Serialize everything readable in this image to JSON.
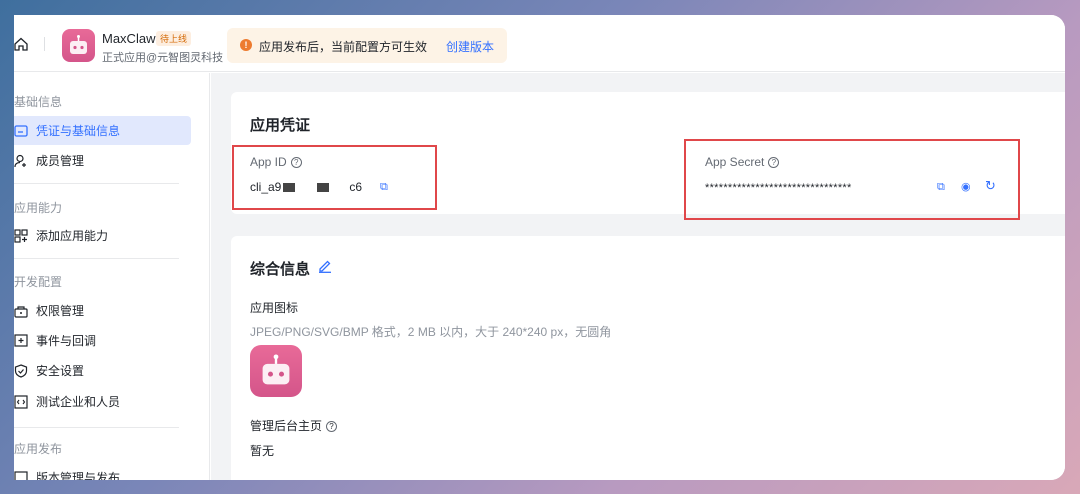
{
  "header": {
    "app_name": "MaxClaw",
    "status_badge": "待上线",
    "app_subtitle": "正式应用@元智图灵科技",
    "notice": {
      "text": "应用发布后，当前配置方可生效",
      "link": "创建版本"
    }
  },
  "sidebar": {
    "groups": [
      {
        "title": "基础信息",
        "items": [
          {
            "label": "凭证与基础信息",
            "active": true
          },
          {
            "label": "成员管理"
          }
        ]
      },
      {
        "title": "应用能力",
        "items": [
          {
            "label": "添加应用能力"
          }
        ]
      },
      {
        "title": "开发配置",
        "items": [
          {
            "label": "权限管理"
          },
          {
            "label": "事件与回调"
          },
          {
            "label": "安全设置"
          },
          {
            "label": "测试企业和人员"
          }
        ]
      },
      {
        "title": "应用发布",
        "items": [
          {
            "label": "版本管理与发布"
          }
        ]
      }
    ]
  },
  "credentials": {
    "title": "应用凭证",
    "app_id_label": "App ID",
    "app_id_prefix": "cli_a9",
    "app_id_suffix": "c6",
    "app_secret_label": "App Secret",
    "app_secret_value": "********************************"
  },
  "general": {
    "title": "综合信息",
    "icon_label": "应用图标",
    "icon_hint": "JPEG/PNG/SVG/BMP 格式，2 MB 以内，大于 240*240 px，无圆角",
    "homepage_label": "管理后台主页",
    "homepage_value": "暂无"
  },
  "colors": {
    "accent": "#3370ff",
    "highlight": "#e0474a",
    "brand": "#dc5c8f"
  }
}
